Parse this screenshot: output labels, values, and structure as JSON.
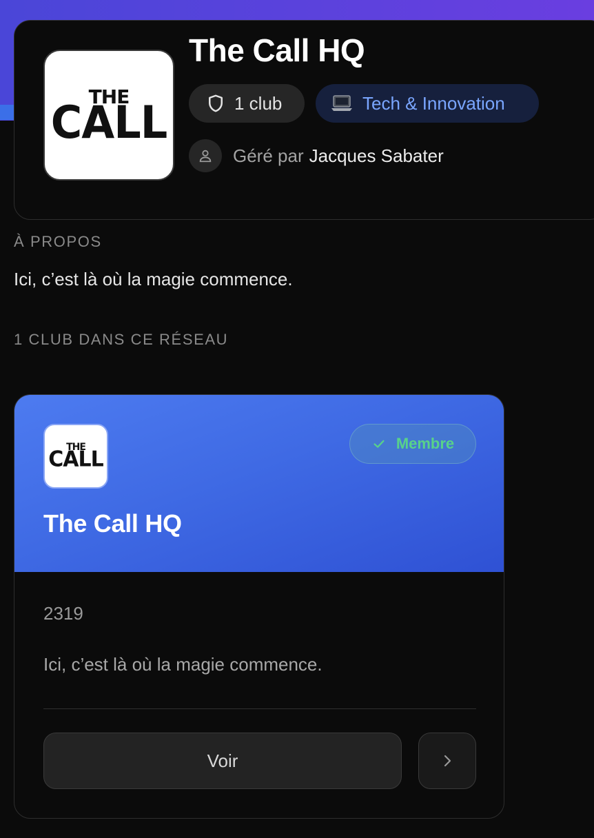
{
  "network": {
    "title": "The Call HQ",
    "logo_text_top": "THE",
    "logo_text_bottom": "CALL",
    "clubs_pill": "1 club",
    "category_pill": "Tech & Innovation",
    "category_icon": "laptop-icon",
    "managed_by_label": "Géré par",
    "manager_name": "Jacques Sabater"
  },
  "about": {
    "label": "À PROPOS",
    "text": "Ici, c’est là où la magie commence."
  },
  "clubs_section": {
    "label": "1 CLUB DANS CE RÉSEAU"
  },
  "club_card": {
    "logo_text_top": "THE",
    "logo_text_bottom": "CALL",
    "member_badge": "Membre",
    "name": "The Call HQ",
    "number": "2319",
    "description": "Ici, c’est là où la magie commence.",
    "view_button": "Voir"
  },
  "colors": {
    "accent_blue": "#3f6ae4",
    "header_gradient_start": "#4a46d8",
    "member_green": "#58d28a",
    "category_text": "#7aa6ff"
  }
}
